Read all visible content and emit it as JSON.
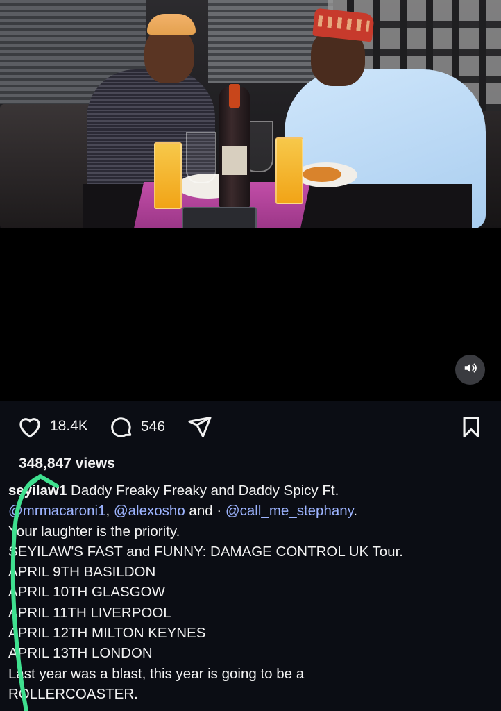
{
  "post": {
    "likes": "18.4K",
    "comments": "546",
    "views": "348,847 views"
  },
  "caption": {
    "username": "seyilaw1",
    "title": " Daddy Freaky Freaky and Daddy Spicy Ft.",
    "mentions": [
      "@mrmacaroni1",
      "@alexosho",
      "@call_me_stephany"
    ],
    "sep1": ", ",
    "and_text": " and · ",
    "end_dot": ".",
    "lines": [
      "Your laughter is the priority.",
      "SEYILAW'S FAST and FUNNY: DAMAGE CONTROL UK Tour.",
      "APRIL 9TH BASILDON",
      "APRIL 10TH GLASGOW",
      "APRIL 11TH LIVERPOOL",
      "APRIL 12TH MILTON KEYNES",
      "APRIL 13TH LONDON",
      "Last year was a blast, this year is going to be a",
      "ROLLERCOASTER."
    ]
  },
  "icons": {
    "like": "heart-icon",
    "comment": "comment-bubble-icon",
    "share": "paper-plane-icon",
    "save": "bookmark-icon",
    "audio": "speaker-icon"
  },
  "colors": {
    "background": "#0b0d14",
    "text": "#f2f2f2",
    "mention": "#9db4ff",
    "annotation": "#3fe08f"
  }
}
